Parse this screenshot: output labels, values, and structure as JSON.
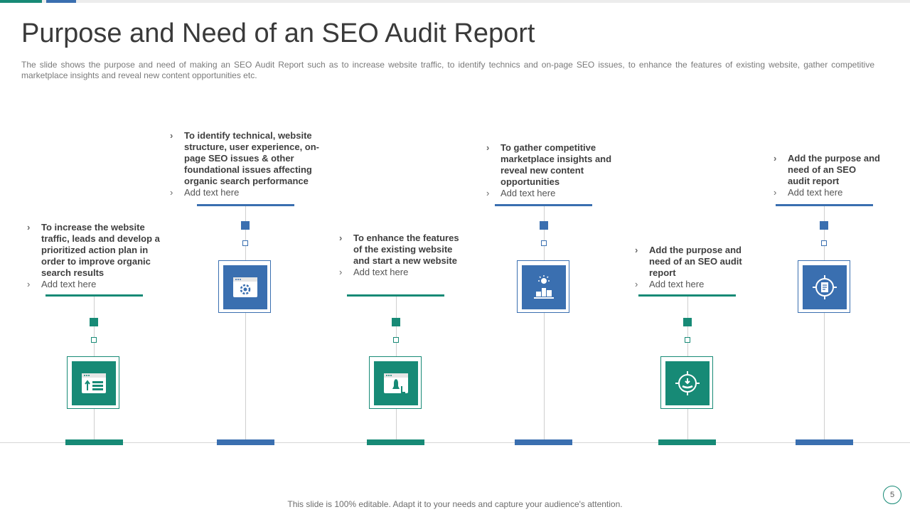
{
  "slide": {
    "title": "Purpose and Need of an SEO Audit Report",
    "subtitle": "The slide shows the purpose and need of making an SEO Audit Report such as to increase website traffic, to identify technics and on-page SEO issues, to enhance the features of existing website, gather competitive marketplace insights and reveal new content opportunities etc.",
    "footer": "This slide is 100% editable. Adapt it to your needs and capture your audience's attention.",
    "page_number": "5",
    "colors": {
      "green": "#178a76",
      "blue": "#3a6fb0"
    }
  },
  "steps": [
    {
      "color": "green",
      "icon": "browser-upload-list-icon",
      "heading": "To increase the website traffic, leads and develop a prioritized action plan in order to improve organic search results",
      "sub": "Add text here"
    },
    {
      "color": "blue",
      "icon": "browser-gear-icon",
      "heading": "To identify technical, website structure, user experience, on-page SEO issues & other foundational issues affecting organic search performance",
      "sub": "Add text here"
    },
    {
      "color": "green",
      "icon": "browser-rocket-icon",
      "heading": "To enhance the features of the existing website and start a new website",
      "sub": "Add text here"
    },
    {
      "color": "blue",
      "icon": "podium-idea-icon",
      "heading": "To gather competitive marketplace insights and reveal new content opportunities",
      "sub": "Add text here"
    },
    {
      "color": "green",
      "icon": "target-hand-icon",
      "heading": "Add the purpose and need of an SEO audit report",
      "sub": "Add text here"
    },
    {
      "color": "blue",
      "icon": "target-report-icon",
      "heading": "Add the purpose and need of an SEO audit report",
      "sub": "Add text here"
    }
  ]
}
